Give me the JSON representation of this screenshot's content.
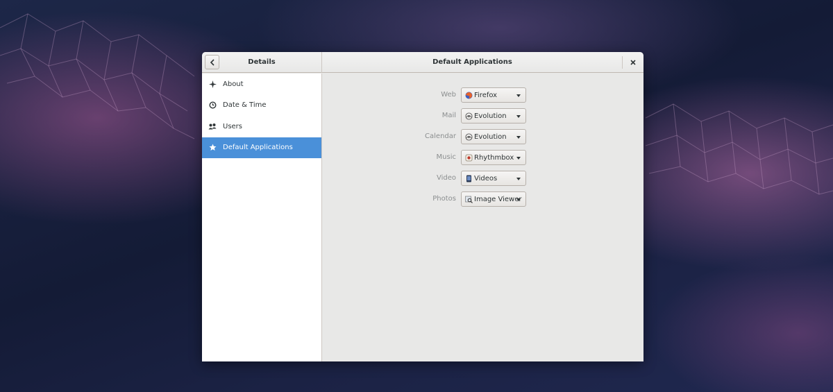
{
  "window": {
    "sidebar_title": "Details",
    "main_title": "Default Applications"
  },
  "sidebar": {
    "items": [
      {
        "label": "About",
        "icon": "star-sparkle-icon"
      },
      {
        "label": "Date & Time",
        "icon": "clock-icon"
      },
      {
        "label": "Users",
        "icon": "users-icon"
      },
      {
        "label": "Default Applications",
        "icon": "star-icon",
        "selected": true
      }
    ]
  },
  "defaults": {
    "rows": [
      {
        "label": "Web",
        "app": "Firefox",
        "icon": "firefox-icon"
      },
      {
        "label": "Mail",
        "app": "Evolution",
        "icon": "evolution-icon"
      },
      {
        "label": "Calendar",
        "app": "Evolution",
        "icon": "evolution-icon"
      },
      {
        "label": "Music",
        "app": "Rhythmbox",
        "icon": "rhythmbox-icon"
      },
      {
        "label": "Video",
        "app": "Videos",
        "icon": "videos-icon"
      },
      {
        "label": "Photos",
        "app": "Image Viewer",
        "icon": "image-viewer-icon"
      }
    ]
  },
  "colors": {
    "selection": "#4a90d9",
    "content_bg": "#e8e8e7",
    "sidebar_bg": "#ffffff"
  }
}
